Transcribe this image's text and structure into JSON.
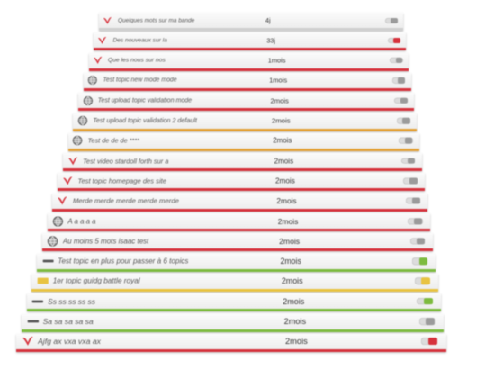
{
  "colors": {
    "red": "#d6323c",
    "orange": "#e3a23a",
    "green": "#7dbb3f",
    "gray": "#cfcfcf",
    "yellow": "#e8c341"
  },
  "rows": [
    {
      "icon": "heart-bird-icon",
      "icon_color": "#d6323c",
      "title": "Quelques mots sur ma bande",
      "date": "4j",
      "status": "gray",
      "toggle": "gray-off"
    },
    {
      "icon": "heart-bird-icon",
      "icon_color": "#d6323c",
      "title": "Des nouveaux sur la",
      "date": "33j",
      "status": "red",
      "toggle": "red"
    },
    {
      "icon": "heart-bird-icon",
      "icon_color": "#d6323c",
      "title": "Que les nous sur nos",
      "date": "1mois",
      "status": "red",
      "toggle": "gray-off"
    },
    {
      "icon": "globe-icon",
      "icon_color": "#777777",
      "title": "Test topic new mode mode",
      "date": "1mois",
      "status": "red",
      "toggle": "gray-off"
    },
    {
      "icon": "globe-icon",
      "icon_color": "#777777",
      "title": "Test upload topic validation mode",
      "date": "2mois",
      "status": "red",
      "toggle": "gray-off"
    },
    {
      "icon": "globe-icon",
      "icon_color": "#777777",
      "title": "Test upload topic validation 2 default",
      "date": "2mois",
      "status": "orange",
      "toggle": "gray-off"
    },
    {
      "icon": "globe-icon",
      "icon_color": "#777777",
      "title": "Test de de de ****",
      "date": "2mois",
      "status": "orange",
      "toggle": "gray-off"
    },
    {
      "icon": "heart-bird-icon",
      "icon_color": "#d6323c",
      "title": "Test video stardoll forth sur a",
      "date": "2mois",
      "status": "red",
      "toggle": "gray-off"
    },
    {
      "icon": "heart-bird-icon",
      "icon_color": "#d6323c",
      "title": "Test topic homepage des site",
      "date": "2mois",
      "status": "red",
      "toggle": "gray-off"
    },
    {
      "icon": "heart-bird-icon",
      "icon_color": "#d6323c",
      "title": "Merde merde merde merde merde",
      "date": "2mois",
      "status": "red",
      "toggle": "gray-off"
    },
    {
      "icon": "globe-icon",
      "icon_color": "#777777",
      "title": "A a a a a",
      "date": "2mois",
      "status": "red",
      "toggle": "gray-off"
    },
    {
      "icon": "globe-icon",
      "icon_color": "#777777",
      "title": "Au moins 5 mots isaac test",
      "date": "2mois",
      "status": "red",
      "toggle": "gray-off"
    },
    {
      "icon": "dash-icon",
      "icon_color": "#555555",
      "title": "Test topic en plus pour passer à 6 topics",
      "date": "2mois",
      "status": "green",
      "toggle": "green"
    },
    {
      "icon": "bar-icon",
      "icon_color": "#e8c341",
      "title": "1er topic guidg battle royal",
      "date": "2mois",
      "status": "yellow",
      "toggle": "yellow"
    },
    {
      "icon": "dash-icon",
      "icon_color": "#555555",
      "title": "Ss ss ss ss ss",
      "date": "2mois",
      "status": "green",
      "toggle": "green"
    },
    {
      "icon": "dash-icon",
      "icon_color": "#555555",
      "title": "Sa sa sa sa sa",
      "date": "2mois",
      "status": "green",
      "toggle": "gray-off"
    },
    {
      "icon": "heart-bird-icon",
      "icon_color": "#d6323c",
      "title": "Ajfg ax vxa vxa ax",
      "date": "2mois",
      "status": "red",
      "toggle": "red"
    }
  ]
}
